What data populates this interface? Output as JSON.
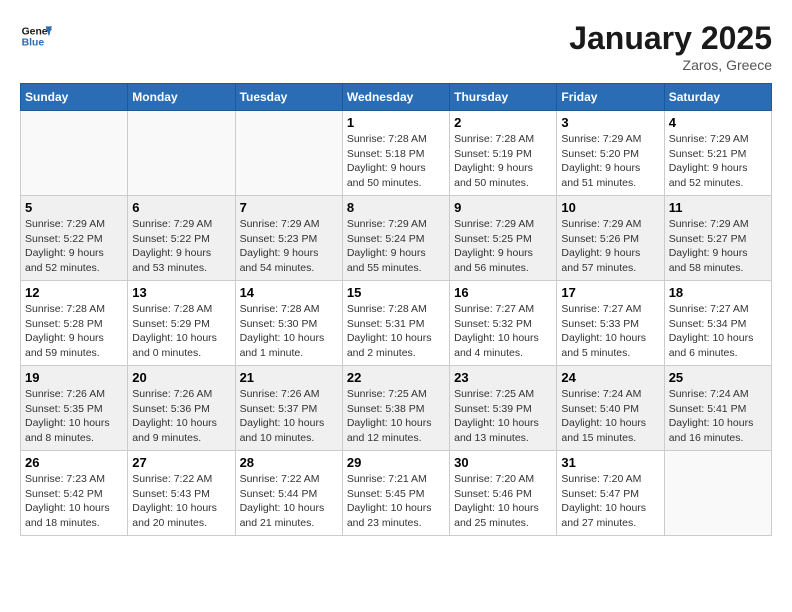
{
  "header": {
    "logo_line1": "General",
    "logo_line2": "Blue",
    "title": "January 2025",
    "subtitle": "Zaros, Greece"
  },
  "weekdays": [
    "Sunday",
    "Monday",
    "Tuesday",
    "Wednesday",
    "Thursday",
    "Friday",
    "Saturday"
  ],
  "weeks": [
    [
      {
        "day": "",
        "empty": true
      },
      {
        "day": "",
        "empty": true
      },
      {
        "day": "",
        "empty": true
      },
      {
        "day": "1",
        "sunrise": "7:28 AM",
        "sunset": "5:18 PM",
        "daylight": "9 hours and 50 minutes."
      },
      {
        "day": "2",
        "sunrise": "7:28 AM",
        "sunset": "5:19 PM",
        "daylight": "9 hours and 50 minutes."
      },
      {
        "day": "3",
        "sunrise": "7:29 AM",
        "sunset": "5:20 PM",
        "daylight": "9 hours and 51 minutes."
      },
      {
        "day": "4",
        "sunrise": "7:29 AM",
        "sunset": "5:21 PM",
        "daylight": "9 hours and 52 minutes."
      }
    ],
    [
      {
        "day": "5",
        "sunrise": "7:29 AM",
        "sunset": "5:22 PM",
        "daylight": "9 hours and 52 minutes."
      },
      {
        "day": "6",
        "sunrise": "7:29 AM",
        "sunset": "5:22 PM",
        "daylight": "9 hours and 53 minutes."
      },
      {
        "day": "7",
        "sunrise": "7:29 AM",
        "sunset": "5:23 PM",
        "daylight": "9 hours and 54 minutes."
      },
      {
        "day": "8",
        "sunrise": "7:29 AM",
        "sunset": "5:24 PM",
        "daylight": "9 hours and 55 minutes."
      },
      {
        "day": "9",
        "sunrise": "7:29 AM",
        "sunset": "5:25 PM",
        "daylight": "9 hours and 56 minutes."
      },
      {
        "day": "10",
        "sunrise": "7:29 AM",
        "sunset": "5:26 PM",
        "daylight": "9 hours and 57 minutes."
      },
      {
        "day": "11",
        "sunrise": "7:29 AM",
        "sunset": "5:27 PM",
        "daylight": "9 hours and 58 minutes."
      }
    ],
    [
      {
        "day": "12",
        "sunrise": "7:28 AM",
        "sunset": "5:28 PM",
        "daylight": "9 hours and 59 minutes."
      },
      {
        "day": "13",
        "sunrise": "7:28 AM",
        "sunset": "5:29 PM",
        "daylight": "10 hours and 0 minutes."
      },
      {
        "day": "14",
        "sunrise": "7:28 AM",
        "sunset": "5:30 PM",
        "daylight": "10 hours and 1 minute."
      },
      {
        "day": "15",
        "sunrise": "7:28 AM",
        "sunset": "5:31 PM",
        "daylight": "10 hours and 2 minutes."
      },
      {
        "day": "16",
        "sunrise": "7:27 AM",
        "sunset": "5:32 PM",
        "daylight": "10 hours and 4 minutes."
      },
      {
        "day": "17",
        "sunrise": "7:27 AM",
        "sunset": "5:33 PM",
        "daylight": "10 hours and 5 minutes."
      },
      {
        "day": "18",
        "sunrise": "7:27 AM",
        "sunset": "5:34 PM",
        "daylight": "10 hours and 6 minutes."
      }
    ],
    [
      {
        "day": "19",
        "sunrise": "7:26 AM",
        "sunset": "5:35 PM",
        "daylight": "10 hours and 8 minutes."
      },
      {
        "day": "20",
        "sunrise": "7:26 AM",
        "sunset": "5:36 PM",
        "daylight": "10 hours and 9 minutes."
      },
      {
        "day": "21",
        "sunrise": "7:26 AM",
        "sunset": "5:37 PM",
        "daylight": "10 hours and 10 minutes."
      },
      {
        "day": "22",
        "sunrise": "7:25 AM",
        "sunset": "5:38 PM",
        "daylight": "10 hours and 12 minutes."
      },
      {
        "day": "23",
        "sunrise": "7:25 AM",
        "sunset": "5:39 PM",
        "daylight": "10 hours and 13 minutes."
      },
      {
        "day": "24",
        "sunrise": "7:24 AM",
        "sunset": "5:40 PM",
        "daylight": "10 hours and 15 minutes."
      },
      {
        "day": "25",
        "sunrise": "7:24 AM",
        "sunset": "5:41 PM",
        "daylight": "10 hours and 16 minutes."
      }
    ],
    [
      {
        "day": "26",
        "sunrise": "7:23 AM",
        "sunset": "5:42 PM",
        "daylight": "10 hours and 18 minutes."
      },
      {
        "day": "27",
        "sunrise": "7:22 AM",
        "sunset": "5:43 PM",
        "daylight": "10 hours and 20 minutes."
      },
      {
        "day": "28",
        "sunrise": "7:22 AM",
        "sunset": "5:44 PM",
        "daylight": "10 hours and 21 minutes."
      },
      {
        "day": "29",
        "sunrise": "7:21 AM",
        "sunset": "5:45 PM",
        "daylight": "10 hours and 23 minutes."
      },
      {
        "day": "30",
        "sunrise": "7:20 AM",
        "sunset": "5:46 PM",
        "daylight": "10 hours and 25 minutes."
      },
      {
        "day": "31",
        "sunrise": "7:20 AM",
        "sunset": "5:47 PM",
        "daylight": "10 hours and 27 minutes."
      },
      {
        "day": "",
        "empty": true
      }
    ]
  ]
}
